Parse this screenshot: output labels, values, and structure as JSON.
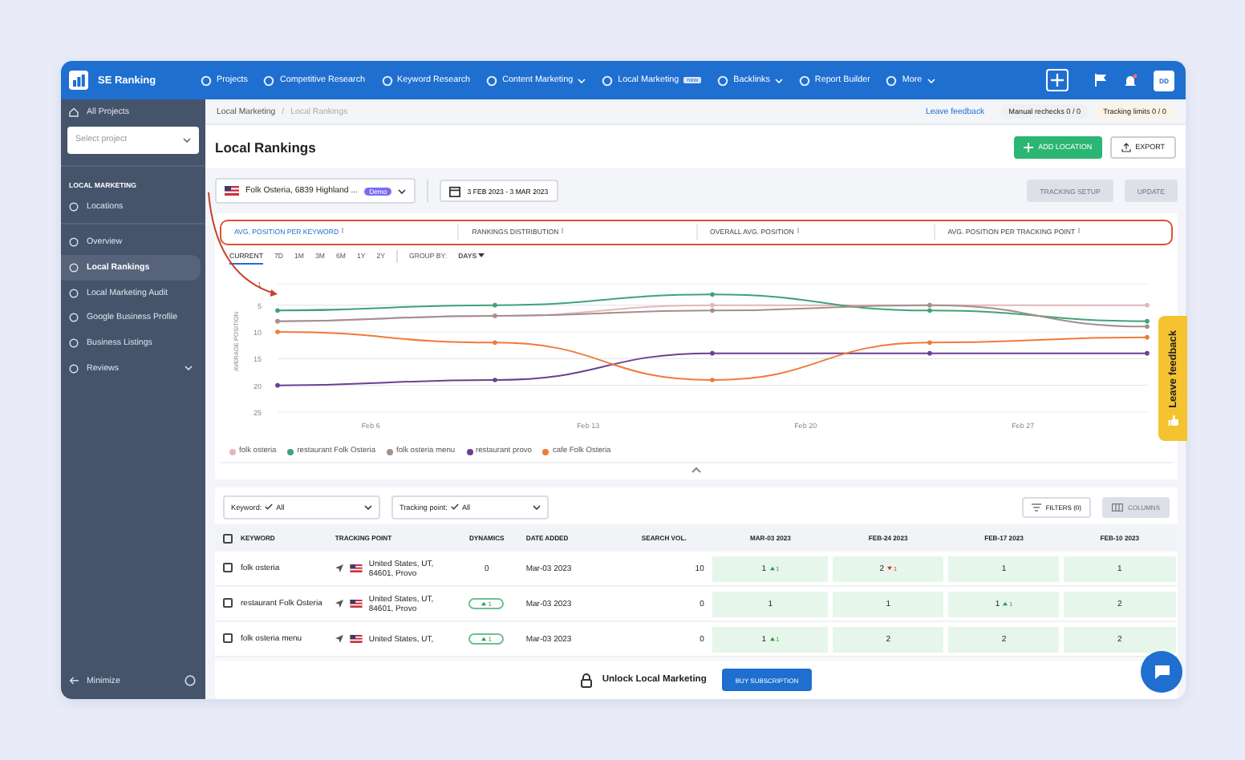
{
  "nav": {
    "brand": "SE Ranking",
    "items": [
      {
        "label": "Projects",
        "dropdown": false
      },
      {
        "label": "Competitive Research",
        "dropdown": false
      },
      {
        "label": "Keyword Research",
        "dropdown": false
      },
      {
        "label": "Content Marketing",
        "dropdown": true
      },
      {
        "label": "Local Marketing",
        "dropdown": false,
        "badge": "new"
      },
      {
        "label": "Backlinks",
        "dropdown": true
      },
      {
        "label": "Report Builder",
        "dropdown": false
      },
      {
        "label": "More",
        "dropdown": true
      }
    ],
    "avatar": "DD"
  },
  "sidebar": {
    "all_projects": "All Projects",
    "project_select": {
      "placeholder": "Select project"
    },
    "section": "LOCAL MARKETING",
    "section_items": [
      {
        "label": "Locations",
        "selected": false,
        "expandable": false
      }
    ],
    "menu": [
      {
        "label": "Overview",
        "selected": false,
        "expandable": false
      },
      {
        "label": "Local Rankings",
        "selected": true,
        "expandable": false
      },
      {
        "label": "Local Marketing Audit",
        "selected": false,
        "expandable": false
      },
      {
        "label": "Google Business Profile",
        "selected": false,
        "expandable": false
      },
      {
        "label": "Business Listings",
        "selected": false,
        "expandable": false
      },
      {
        "label": "Reviews",
        "selected": false,
        "expandable": true
      }
    ],
    "minimize": "Minimize"
  },
  "breadcrumb": [
    "Local Marketing",
    "Local Rankings"
  ],
  "breadcrumb_separator": "/",
  "feedback_link": "Leave feedback",
  "limits": [
    {
      "label": "Manual rechecks",
      "value": "0 / 0"
    },
    {
      "label": "Tracking limits",
      "value": "0 / 0"
    }
  ],
  "title": "Local Rankings",
  "actions": [
    {
      "label": "ADD LOCATION",
      "kind": "primary"
    },
    {
      "label": "EXPORT",
      "kind": "secondary"
    }
  ],
  "location_select": {
    "value": "Folk Osteria, 6839 Highland ...",
    "badge": "Demo"
  },
  "date_range": "3 FEB 2023 - 3 MAR 2023",
  "tools": [
    {
      "label": "TRACKING SETUP",
      "disabled": true
    },
    {
      "label": "UPDATE",
      "disabled": true
    }
  ],
  "report_tabs": [
    {
      "label": "AVG. POSITION PER KEYWORD",
      "selected": true
    },
    {
      "label": "RANKINGS DISTRIBUTION",
      "selected": false
    },
    {
      "label": "OVERALL AVG. POSITION",
      "selected": false
    },
    {
      "label": "AVG. POSITION PER TRACKING POINT",
      "selected": false
    }
  ],
  "periods": [
    {
      "label": "CURRENT",
      "selected": true
    },
    {
      "label": "7D",
      "selected": false
    },
    {
      "label": "1M",
      "selected": false
    },
    {
      "label": "3M",
      "selected": false
    },
    {
      "label": "6M",
      "selected": false
    },
    {
      "label": "1Y",
      "selected": false
    },
    {
      "label": "2Y",
      "selected": false
    }
  ],
  "group_by": {
    "label": "GROUP BY:",
    "value": "DAYS"
  },
  "chart_data": {
    "type": "line",
    "ylabel": "AVERAGE POSITION",
    "grid": true,
    "ylim": [
      25,
      1
    ],
    "categories": [
      null,
      null,
      null,
      "Feb 6",
      null,
      null,
      null,
      null,
      null,
      null,
      "Feb 13",
      null,
      null,
      null,
      null,
      null,
      null,
      "Feb 20",
      null,
      null,
      null,
      null,
      null,
      null,
      "Feb 27",
      null,
      null,
      null,
      null
    ],
    "yticks": [
      1,
      5,
      10,
      15,
      20,
      25
    ],
    "series": [
      {
        "name": "folk osteria",
        "color": "#e3b7b9",
        "values": [
          8,
          null,
          null,
          null,
          null,
          null,
          null,
          7,
          null,
          null,
          null,
          null,
          null,
          null,
          5,
          null,
          null,
          null,
          null,
          null,
          null,
          5,
          null,
          null,
          null,
          null,
          null,
          null,
          5
        ]
      },
      {
        "name": "restaurant Folk Osteria",
        "color": "#3fa27a",
        "values": [
          6,
          null,
          null,
          null,
          null,
          null,
          null,
          5,
          null,
          null,
          null,
          null,
          null,
          null,
          3,
          null,
          null,
          null,
          null,
          null,
          null,
          6,
          null,
          null,
          null,
          null,
          null,
          null,
          8
        ]
      },
      {
        "name": "folk osteria menu",
        "color": "#a48e8e",
        "values": [
          8,
          null,
          null,
          null,
          null,
          null,
          null,
          7,
          null,
          null,
          null,
          null,
          null,
          null,
          6,
          null,
          null,
          null,
          null,
          null,
          null,
          5,
          null,
          null,
          null,
          null,
          null,
          null,
          9
        ]
      },
      {
        "name": "restaurant provo",
        "color": "#6c3f8f",
        "values": [
          20,
          null,
          null,
          null,
          null,
          null,
          null,
          19,
          null,
          null,
          null,
          null,
          null,
          null,
          14,
          null,
          null,
          null,
          null,
          null,
          null,
          14,
          null,
          null,
          null,
          null,
          null,
          null,
          14
        ]
      },
      {
        "name": "cafe Folk Osteria",
        "color": "#f07a3a",
        "values": [
          10,
          null,
          null,
          null,
          null,
          null,
          null,
          12,
          null,
          null,
          null,
          null,
          null,
          null,
          19,
          null,
          null,
          null,
          null,
          null,
          null,
          12,
          null,
          null,
          null,
          null,
          null,
          null,
          11
        ]
      }
    ]
  },
  "table": {
    "filters": [
      {
        "label": "Keyword:",
        "value": "All"
      },
      {
        "label": "Tracking point:",
        "value": "All"
      }
    ],
    "filters_button": "FILTERS (0)",
    "columns_button": {
      "label": "COLUMNS",
      "disabled": true
    },
    "header_checked": false,
    "columns": [
      "KEYWORD",
      "TRACKING POINT",
      "DYNAMICS",
      "DATE ADDED",
      "SEARCH VOL.",
      "MAR-03 2023",
      "FEB-24 2023",
      "FEB-17 2023",
      "FEB-10 2023"
    ],
    "rows": [
      {
        "checked": false,
        "keyword": "folk osteria",
        "tracking_point": "United States, UT, 84601, Provo",
        "dynamics": {
          "value": "0",
          "rising": false
        },
        "date_added": "Mar-03 2023",
        "search_vol": "10",
        "positions": [
          {
            "value": "1",
            "change": "1",
            "rising": true
          },
          {
            "value": "2",
            "change": "1",
            "rising": false
          },
          {
            "value": "1"
          },
          {
            "value": "1"
          }
        ]
      },
      {
        "checked": false,
        "keyword": "restaurant Folk Osteria",
        "tracking_point": "United States, UT, 84601, Provo",
        "dynamics": {
          "value": "1",
          "rising": true
        },
        "date_added": "Mar-03 2023",
        "search_vol": "0",
        "positions": [
          {
            "value": "1"
          },
          {
            "value": "1"
          },
          {
            "value": "1",
            "change": "1",
            "rising": true
          },
          {
            "value": "2"
          }
        ]
      },
      {
        "checked": false,
        "keyword": "folk osteria menu",
        "tracking_point": "United States, UT,",
        "dynamics": {
          "value": "1",
          "rising": true
        },
        "date_added": "Mar-03 2023",
        "search_vol": "0",
        "positions": [
          {
            "value": "1",
            "change": "1",
            "rising": true
          },
          {
            "value": "2"
          },
          {
            "value": "2"
          },
          {
            "value": "2"
          }
        ]
      }
    ]
  },
  "banner": {
    "text": "Unlock Local Marketing",
    "button": "BUY SUBSCRIPTION"
  },
  "feedback_tab": "Leave feedback"
}
